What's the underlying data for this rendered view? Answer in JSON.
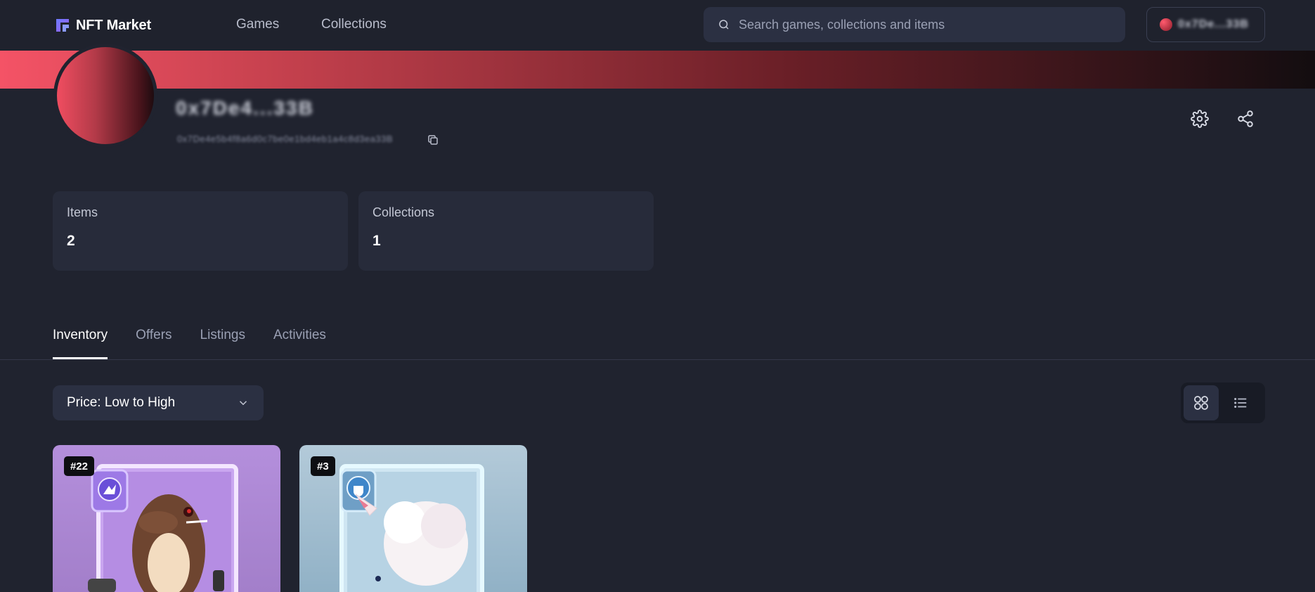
{
  "header": {
    "logo_text": "NFT Market",
    "nav": [
      "Games",
      "Collections"
    ],
    "search_placeholder": "Search games, collections and items",
    "wallet_label": "0x7De...33B"
  },
  "profile": {
    "username": "0x7De4...33B",
    "address": "0x7De4e5b4f8a6d0c7be0e1bd4eb1a4c8d3ea33B"
  },
  "stats": [
    {
      "label": "Items",
      "value": "2"
    },
    {
      "label": "Collections",
      "value": "1"
    }
  ],
  "tabs": [
    {
      "label": "Inventory",
      "active": true
    },
    {
      "label": "Offers",
      "active": false
    },
    {
      "label": "Listings",
      "active": false
    },
    {
      "label": "Activities",
      "active": false
    }
  ],
  "sort": {
    "selected": "Price: Low to High"
  },
  "items": [
    {
      "badge": "#22"
    },
    {
      "badge": "#3"
    }
  ],
  "colors": {
    "background": "#20232f",
    "accent": "#f45366"
  }
}
